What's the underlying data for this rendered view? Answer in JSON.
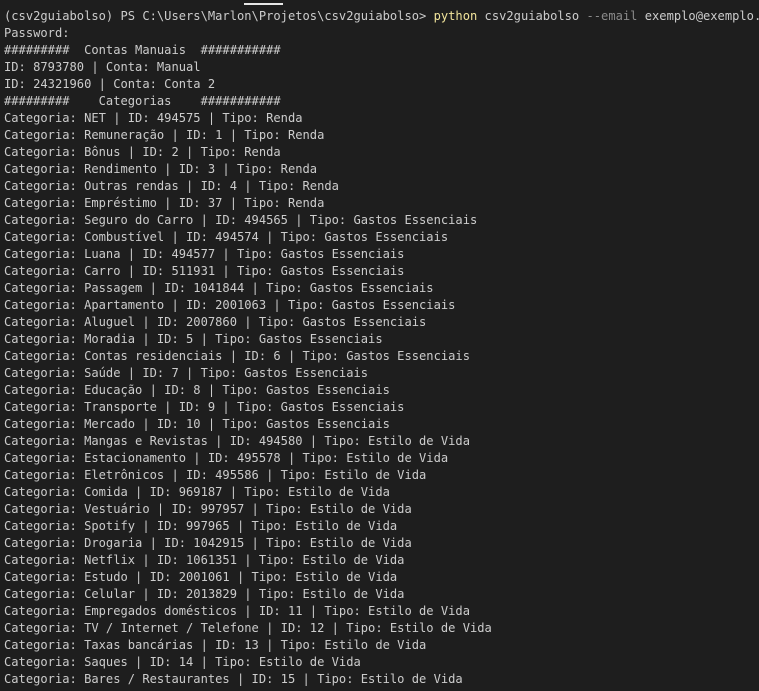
{
  "terminal": {
    "prompt": {
      "text": "(csv2guiabolso) PS C:\\Users\\Marlon\\Projetos\\csv2guiabolso> ",
      "command": "python",
      "argument": " csv2guiabolso ",
      "param": "--email",
      "param_value": " exemplo@exemplo.com"
    },
    "lines": [
      "Password:",
      "#########  Contas Manuais  ###########",
      "ID: 8793780 | Conta: Manual",
      "ID: 24321960 | Conta: Conta 2",
      "#########    Categorias    ###########",
      "Categoria: NET | ID: 494575 | Tipo: Renda",
      "Categoria: Remuneração | ID: 1 | Tipo: Renda",
      "Categoria: Bônus | ID: 2 | Tipo: Renda",
      "Categoria: Rendimento | ID: 3 | Tipo: Renda",
      "Categoria: Outras rendas | ID: 4 | Tipo: Renda",
      "Categoria: Empréstimo | ID: 37 | Tipo: Renda",
      "Categoria: Seguro do Carro | ID: 494565 | Tipo: Gastos Essenciais",
      "Categoria: Combustível | ID: 494574 | Tipo: Gastos Essenciais",
      "Categoria: Luana | ID: 494577 | Tipo: Gastos Essenciais",
      "Categoria: Carro | ID: 511931 | Tipo: Gastos Essenciais",
      "Categoria: Passagem | ID: 1041844 | Tipo: Gastos Essenciais",
      "Categoria: Apartamento | ID: 2001063 | Tipo: Gastos Essenciais",
      "Categoria: Aluguel | ID: 2007860 | Tipo: Gastos Essenciais",
      "Categoria: Moradia | ID: 5 | Tipo: Gastos Essenciais",
      "Categoria: Contas residenciais | ID: 6 | Tipo: Gastos Essenciais",
      "Categoria: Saúde | ID: 7 | Tipo: Gastos Essenciais",
      "Categoria: Educação | ID: 8 | Tipo: Gastos Essenciais",
      "Categoria: Transporte | ID: 9 | Tipo: Gastos Essenciais",
      "Categoria: Mercado | ID: 10 | Tipo: Gastos Essenciais",
      "Categoria: Mangas e Revistas | ID: 494580 | Tipo: Estilo de Vida",
      "Categoria: Estacionamento | ID: 495578 | Tipo: Estilo de Vida",
      "Categoria: Eletrônicos | ID: 495586 | Tipo: Estilo de Vida",
      "Categoria: Comida | ID: 969187 | Tipo: Estilo de Vida",
      "Categoria: Vestuário | ID: 997957 | Tipo: Estilo de Vida",
      "Categoria: Spotify | ID: 997965 | Tipo: Estilo de Vida",
      "Categoria: Drogaria | ID: 1042915 | Tipo: Estilo de Vida",
      "Categoria: Netflix | ID: 1061351 | Tipo: Estilo de Vida",
      "Categoria: Estudo | ID: 2001061 | Tipo: Estilo de Vida",
      "Categoria: Celular | ID: 2013829 | Tipo: Estilo de Vida",
      "Categoria: Empregados domésticos | ID: 11 | Tipo: Estilo de Vida",
      "Categoria: TV / Internet / Telefone | ID: 12 | Tipo: Estilo de Vida",
      "Categoria: Taxas bancárias | ID: 13 | Tipo: Estilo de Vida",
      "Categoria: Saques | ID: 14 | Tipo: Estilo de Vida",
      "Categoria: Bares / Restaurantes | ID: 15 | Tipo: Estilo de Vida"
    ]
  },
  "colors": {
    "background": "#1e1e1e",
    "text": "#cccccc",
    "command": "#f1e49b",
    "parameter": "#8a8a8a"
  }
}
